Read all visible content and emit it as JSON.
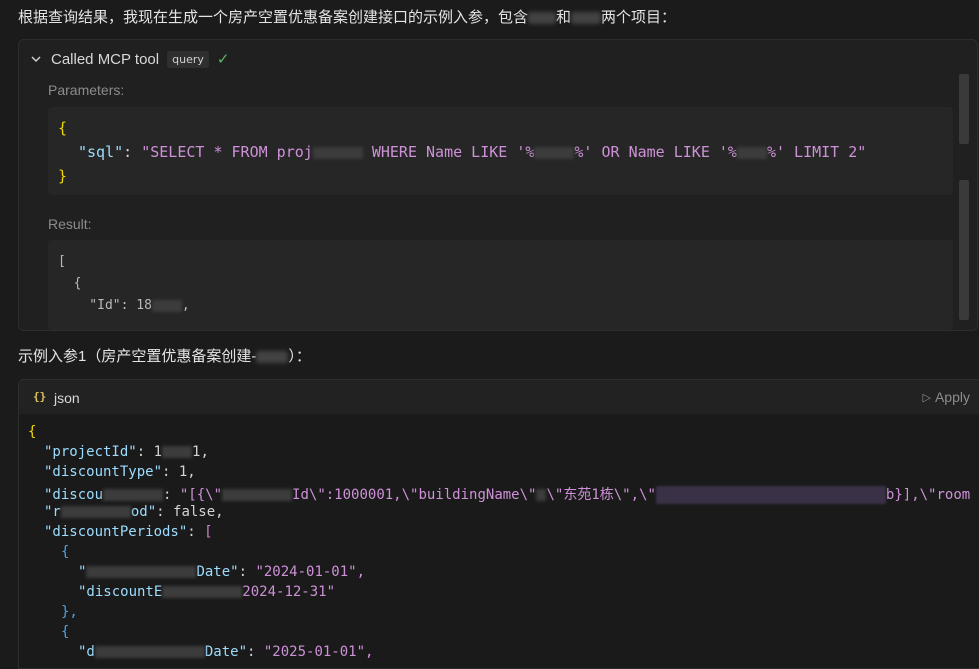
{
  "intro": {
    "text_a": "根据查询结果，我现在生成一个房产空置优惠备案创建接口的示例入参，包含",
    "text_b": "和",
    "text_c": "两个项目："
  },
  "mcp": {
    "title": "Called MCP tool",
    "badge": "query",
    "params_label": "Parameters:",
    "result_label": "Result:",
    "params": {
      "open": "{",
      "key": "\"sql\"",
      "colon": ": ",
      "sql_a": "\"SELECT * FROM proj",
      "sql_b": " WHERE Name LIKE '%",
      "sql_c": "%' OR Name LIKE '%",
      "sql_d": "%' LIMIT 2\"",
      "close": "}"
    },
    "result": {
      "l1": "[",
      "l2": "  {",
      "l3_key": "    \"Id\": 18",
      "l3_end": ","
    }
  },
  "example": {
    "title_a": "示例入参1（房产空置优惠备案创建-",
    "title_b": "）："
  },
  "json_block": {
    "icon": "{}",
    "lang": "json",
    "apply_label": "Apply",
    "lines": {
      "l1": "{",
      "l2_key": "\"projectId\"",
      "l2_val": "1",
      "l2_tail": "1,",
      "l3_key": "\"discountType\"",
      "l3_val": "1,",
      "l4_key": "\"discou",
      "l4_val_a": "\"[{\\\"",
      "l4_val_b": "Id\\\":1000001,\\\"buildingName\\\"",
      "l4_val_c": "\\\"东苑1栋\\\",\\\"",
      "l4_val_d": "b}],\\\"room",
      "l5_key": "\"r",
      "l5_mid": "od\"",
      "l5_val": "false,",
      "l6_key": "\"discountPeriods\"",
      "l6_bracket": "[",
      "l7": "{",
      "l8_key_a": "\"",
      "l8_key_b": "Date\"",
      "l8_val": "\"2024-01-01\",",
      "l9_key": "\"discountE",
      "l9_val": "2024-12-31\"",
      "l10": "},",
      "l11": "{",
      "l12_key_a": "\"d",
      "l12_key_b": "Date\"",
      "l12_val": "\"2025-01-01\","
    }
  }
}
